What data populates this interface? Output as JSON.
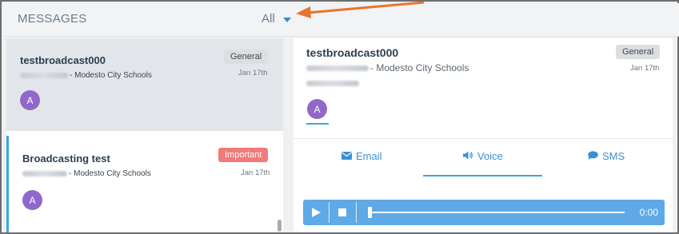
{
  "header": {
    "title": "MESSAGES",
    "filter_label": "All"
  },
  "messages": [
    {
      "title": "testbroadcast000",
      "sender_suffix": "- Modesto City Schools",
      "badge": "General",
      "date": "Jan 17th",
      "avatar": "A"
    },
    {
      "title": "Broadcasting test",
      "sender_suffix": "- Modesto City Schools",
      "badge": "Important",
      "date": "Jan 17th",
      "avatar": "A"
    }
  ],
  "detail": {
    "title": "testbroadcast000",
    "sender_suffix": "- Modesto City Schools",
    "badge": "General",
    "date": "Jan 17th",
    "avatar": "A",
    "tabs": [
      {
        "label": "Email",
        "icon": "envelope-icon"
      },
      {
        "label": "Voice",
        "icon": "speaker-icon"
      },
      {
        "label": "SMS",
        "icon": "chat-bubble-icon"
      }
    ],
    "selected_tab": "Voice",
    "player": {
      "time": "0:00",
      "progress": 0
    }
  },
  "colors": {
    "accent": "#36a9e1",
    "player": "#5ea9e6",
    "important": "#f07a7a",
    "avatar": "#9068c9",
    "annotation_arrow": "#e8742a"
  }
}
